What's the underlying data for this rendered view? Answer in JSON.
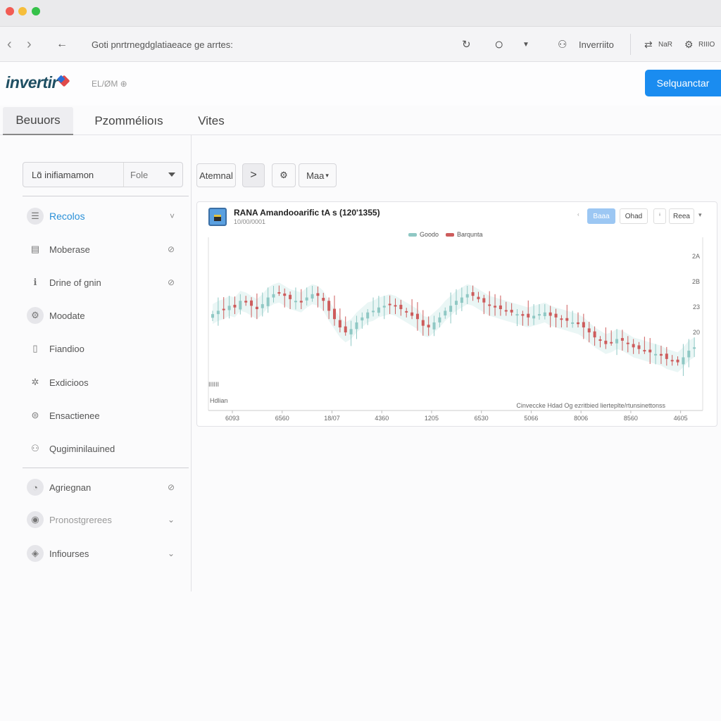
{
  "window": {
    "url_text": "Goti pnrtrnegdglatiaeace ge arrtes:"
  },
  "toolbar": {
    "profile_label": "Inverriito",
    "action1_label": "NaR",
    "action2_label": "RIIIO"
  },
  "brand": {
    "logo": "invertir",
    "subtitle": "EL/ØM ⊕",
    "primary_button": "Selquanctar"
  },
  "tabs": [
    {
      "label": "Beuuors",
      "active": true
    },
    {
      "label": "Pzommélioıs",
      "active": false
    },
    {
      "label": "Vites",
      "active": false
    }
  ],
  "sidebar": {
    "select": {
      "label": "Lɑ̃ inifiamamon",
      "value": "Fole"
    },
    "items": [
      {
        "label": "Recolos",
        "icon": "list-icon",
        "glyph": "☰",
        "active": true,
        "chevron": "˅"
      },
      {
        "label": "Moberase",
        "icon": "document-icon",
        "glyph": "▤",
        "chevron": "⊘"
      },
      {
        "label": "Drine of gnin",
        "icon": "info-icon",
        "glyph": "ℹ",
        "chevron": "⊘"
      },
      {
        "label": "Moodate",
        "icon": "gear-icon",
        "glyph": "⚙"
      },
      {
        "label": "Fiandioo",
        "icon": "file-icon",
        "glyph": "▯"
      },
      {
        "label": "Exdicioos",
        "icon": "settings-icon",
        "glyph": "✲"
      },
      {
        "label": "Ensactienee",
        "icon": "lock-icon",
        "glyph": "⊜"
      },
      {
        "label": "Qugiminilauined",
        "icon": "people-icon",
        "glyph": "⚇"
      }
    ],
    "secondary": [
      {
        "label": "Agriegnan",
        "icon": "user-icon",
        "glyph": "◔",
        "chevron": "⊘"
      },
      {
        "label": "Pronostgrerees",
        "icon": "person-icon",
        "glyph": "◉",
        "chevron": "⌄",
        "muted": true
      },
      {
        "label": "Infiourses",
        "icon": "tag-icon",
        "glyph": "◈",
        "chevron": "⌄"
      }
    ]
  },
  "main_toolbar": {
    "select_label": "Atemnal",
    "next_glyph": ">",
    "tool_label": "Maa"
  },
  "chart_panel": {
    "title": "RANA Amandooarific tA s (120'1355)",
    "subtitle": "10/00/0001",
    "buttons": [
      {
        "label": "Baaa",
        "active": true
      },
      {
        "label": "Ohad"
      },
      {
        "label": "Reea"
      }
    ]
  },
  "chart_data": {
    "type": "candlestick",
    "legend": [
      {
        "name": "Goodo",
        "color": "#8fc8c4"
      },
      {
        "name": "Barqunta",
        "color": "#cd5c5c"
      }
    ],
    "y_ticks": [
      "2A",
      "2B",
      "23",
      "20"
    ],
    "x_ticks": [
      "6093",
      "6560",
      "18/07",
      "4360",
      "1205",
      "6530",
      "5066",
      "8006",
      "8560",
      "4605"
    ],
    "corner_left_label": "Hdlian",
    "corner_mark": "IIIIII",
    "footnote": "Cinveccke Hdad Og ezritbied lierteplte/rtunsinettonss",
    "ylim": [
      0,
      100
    ],
    "series_close": [
      58,
      60,
      61,
      63,
      62,
      66,
      65,
      63,
      61,
      64,
      68,
      70,
      71,
      69,
      67,
      66,
      65,
      68,
      70,
      69,
      66,
      60,
      55,
      50,
      47,
      49,
      53,
      56,
      59,
      60,
      62,
      63,
      64,
      63,
      61,
      59,
      57,
      55,
      51,
      50,
      53,
      56,
      60,
      63,
      66,
      68,
      70,
      69,
      67,
      65,
      63,
      62,
      61,
      60,
      59,
      58,
      57,
      56,
      57,
      58,
      59,
      57,
      56,
      55,
      54,
      53,
      52,
      50,
      47,
      44,
      42,
      40,
      41,
      43,
      42,
      40,
      38,
      37,
      36,
      35,
      34,
      33,
      31,
      30,
      29,
      32,
      36,
      38
    ]
  }
}
